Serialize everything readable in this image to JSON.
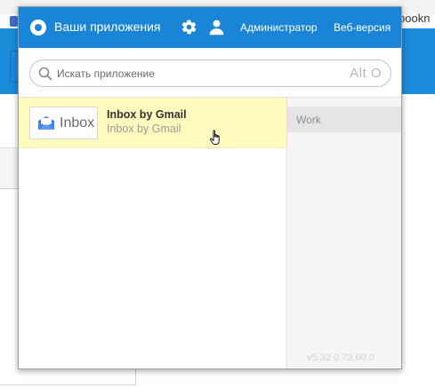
{
  "background": {
    "bookmark_text": "bookn"
  },
  "header": {
    "title": "Ваши приложения",
    "logo_icon": "app-launcher-logo-icon",
    "settings_icon": "gear-icon",
    "user_icon": "user-icon",
    "admin_link": "Администратор",
    "web_version_link": "Веб-версия",
    "accent_color": "#1a85d6"
  },
  "search": {
    "placeholder": "Искать приложение",
    "value": "",
    "shortcut": "Alt O",
    "icon": "search-icon"
  },
  "apps": [
    {
      "logo_text": "Inbox",
      "name": "Inbox by Gmail",
      "subtitle": "Inbox by Gmail",
      "highlight_color": "#fcfbbd"
    }
  ],
  "sidebar": {
    "items": [
      {
        "label": "Work"
      }
    ]
  },
  "footer": {
    "version": "v5.32.0.73.60.0"
  }
}
